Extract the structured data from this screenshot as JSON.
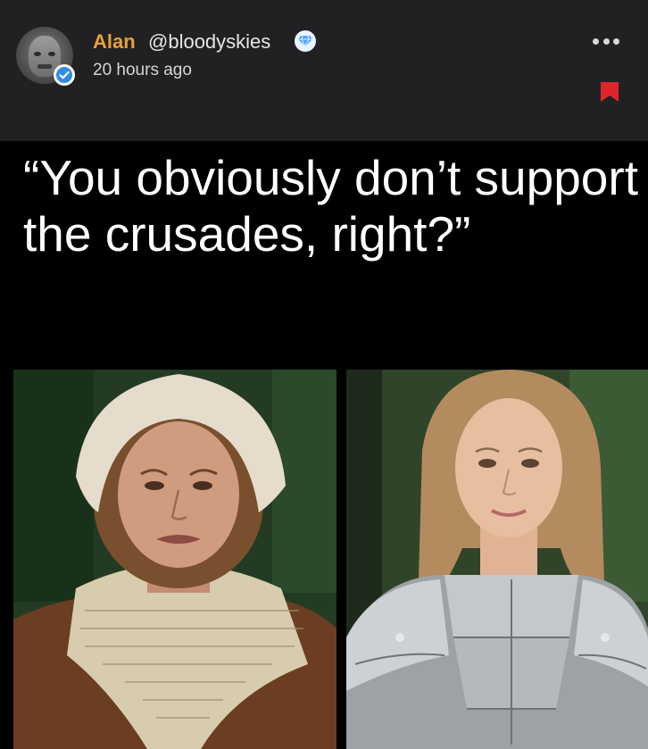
{
  "post": {
    "author_name": "Alan",
    "author_handle": "@bloodyskies",
    "timestamp": "20 hours ago",
    "icons": {
      "avatar": "user-avatar",
      "verified": "verified-badge-icon",
      "premium": "diamond-icon",
      "menu": "more-options-icon",
      "bookmark": "bookmark-icon"
    },
    "colors": {
      "author_name": "#e8a13a",
      "bookmark": "#e0242b",
      "verified": "#2f8ce6"
    }
  },
  "meme": {
    "caption": "“You obviously don’t support the crusades, right?”",
    "left_image": "woman in medieval peasant clothing and headscarf crying",
    "right_image": "woman in silver plate armor smiling"
  }
}
